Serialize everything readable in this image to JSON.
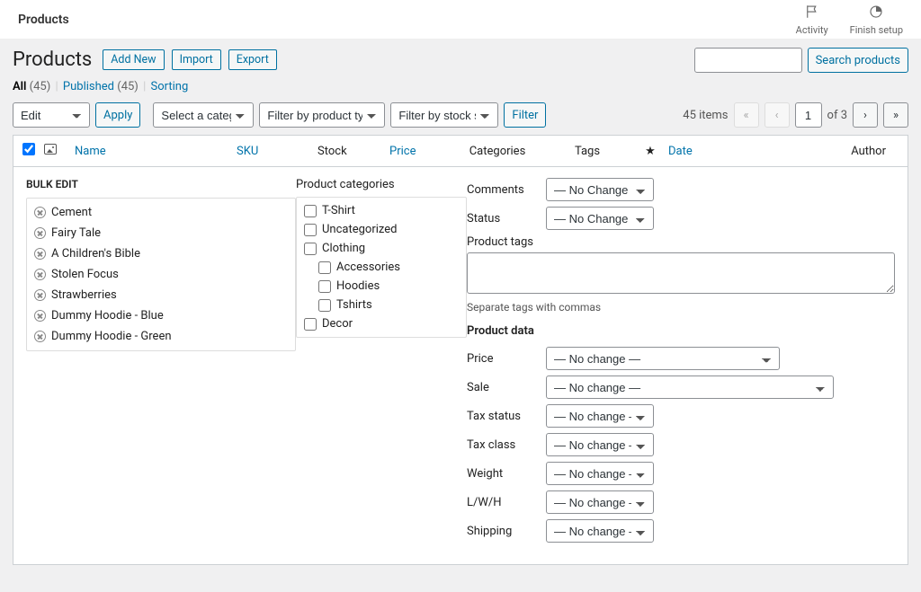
{
  "topbar": {
    "title": "Products",
    "activity": "Activity",
    "finish_setup": "Finish setup"
  },
  "heading": {
    "title": "Products",
    "add_new": "Add New",
    "import": "Import",
    "export": "Export"
  },
  "subsubsub": {
    "all_label": "All",
    "all_count": "(45)",
    "pub_label": "Published",
    "pub_count": "(45)",
    "sorting": "Sorting",
    "sep": "|"
  },
  "search_button": "Search products",
  "bulk_action_select": "Edit",
  "apply": "Apply",
  "filter_cat": "Select a category",
  "filter_type": "Filter by product type",
  "filter_stock": "Filter by stock status",
  "filter_btn": "Filter",
  "pagination": {
    "items": "45 items",
    "current": "1",
    "of": "of 3"
  },
  "columns": {
    "name": "Name",
    "sku": "SKU",
    "stock": "Stock",
    "price": "Price",
    "categories": "Categories",
    "tags": "Tags",
    "date": "Date",
    "author": "Author"
  },
  "bulk": {
    "title": "BULK EDIT",
    "selected": [
      "Cement",
      "Fairy Tale",
      "A Children's Bible",
      "Stolen Focus",
      "Strawberries",
      "Dummy Hoodie - Blue",
      "Dummy Hoodie - Green"
    ],
    "cat_title": "Product categories",
    "categories": [
      {
        "label": "T-Shirt",
        "indent": false
      },
      {
        "label": "Uncategorized",
        "indent": false
      },
      {
        "label": "Clothing",
        "indent": false
      },
      {
        "label": "Accessories",
        "indent": true
      },
      {
        "label": "Hoodies",
        "indent": true
      },
      {
        "label": "Tshirts",
        "indent": true
      },
      {
        "label": "Decor",
        "indent": false
      }
    ],
    "comments_label": "Comments",
    "status_label": "Status",
    "no_change_caps": "— No Change —",
    "no_change": "— No change —",
    "tags_label": "Product tags",
    "tags_hint": "Separate tags with commas",
    "data_title": "Product data",
    "price_label": "Price",
    "sale_label": "Sale",
    "taxstatus_label": "Tax status",
    "taxclass_label": "Tax class",
    "weight_label": "Weight",
    "lwh_label": "L/W/H",
    "shipping_label": "Shipping"
  }
}
